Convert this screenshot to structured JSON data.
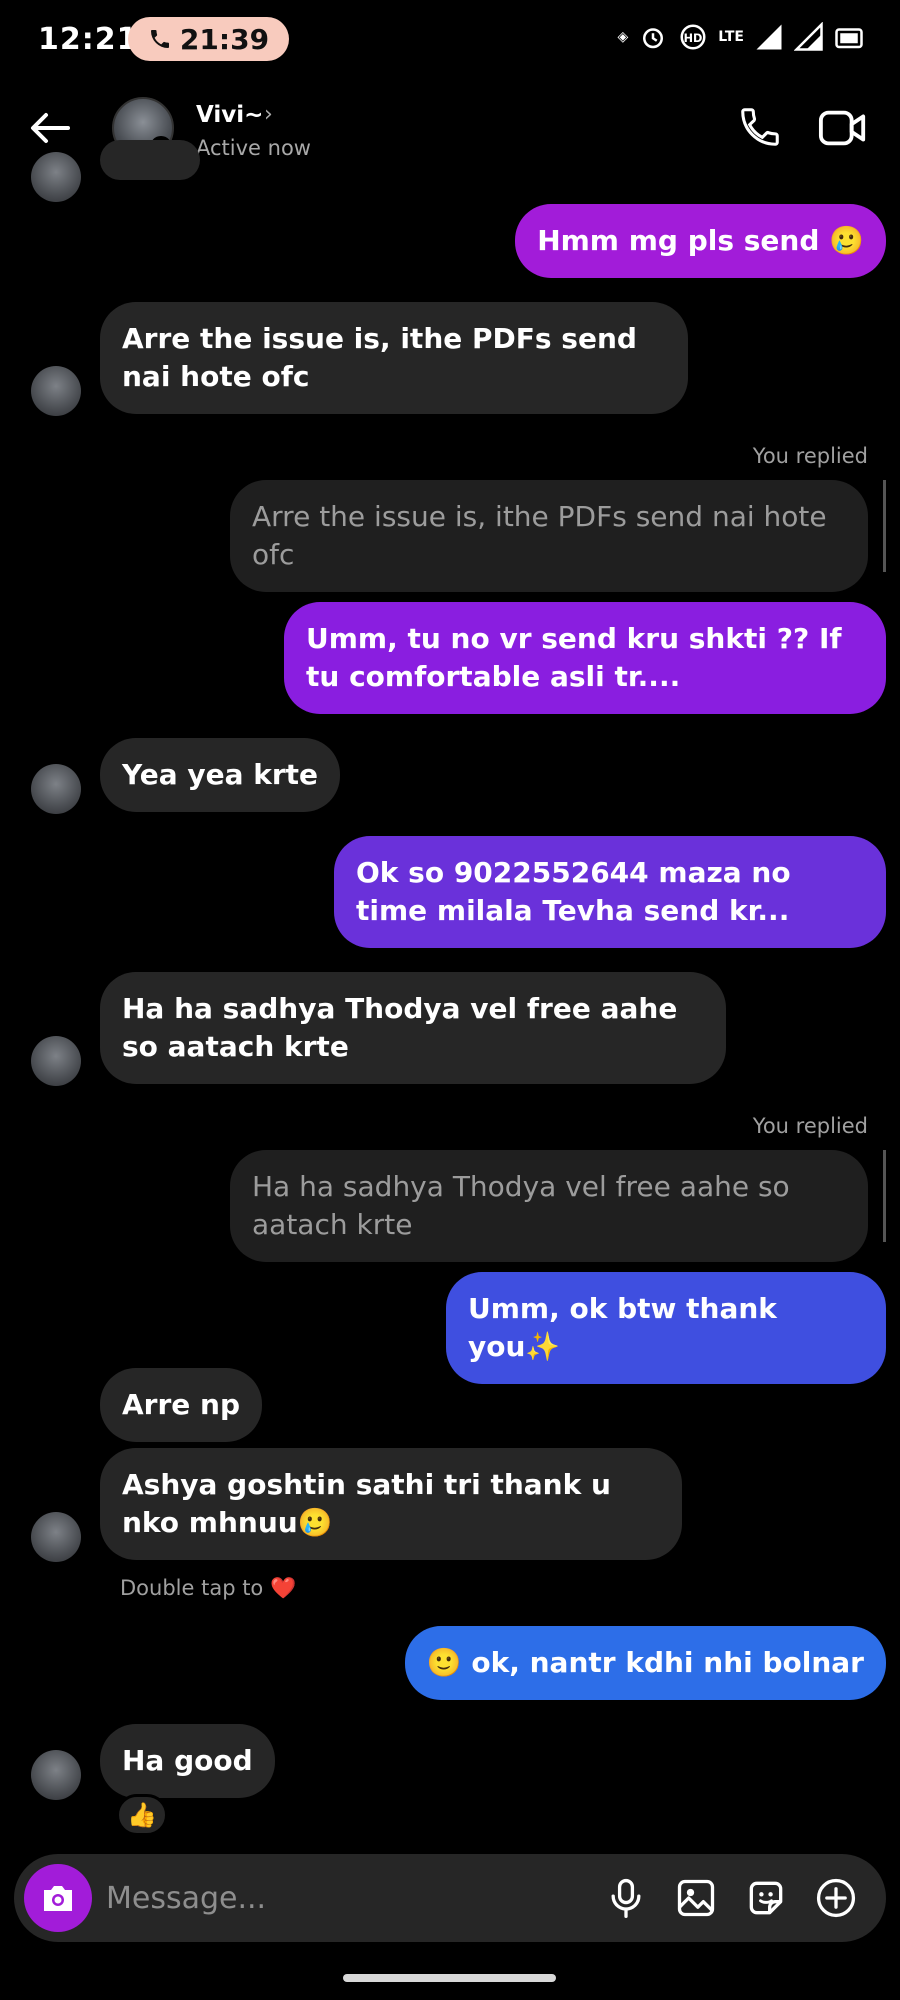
{
  "status_bar": {
    "clock": "12:21",
    "call_time": "21:39",
    "network": "LTE",
    "indicators": [
      "nfc-icon",
      "alarm-icon",
      "volte-icon",
      "lte-icon",
      "signal-icon",
      "signal-icon",
      "battery-icon"
    ]
  },
  "header": {
    "name": "Vivi~",
    "status": "Active now",
    "online_color": "#3ed33e"
  },
  "messages": [
    {
      "from": "me",
      "text": "Hmm mg pls send 🥲",
      "color": "#a21cd9"
    },
    {
      "from": "them",
      "text": "Arre the issue is, ithe PDFs send nai hote ofc"
    },
    {
      "from": "me",
      "replied_label": "You replied",
      "quote": "Arre the issue is, ithe PDFs send nai hote ofc",
      "text": "Umm, tu no vr send kru shkti ?? If tu comfortable asli tr....",
      "color": "#8a1ee0"
    },
    {
      "from": "them",
      "text": "Yea yea krte"
    },
    {
      "from": "me",
      "text": "Ok so 9022552644 maza no time milala Tevha send kr...",
      "color": "#6a31da"
    },
    {
      "from": "them",
      "text": "Ha ha sadhya Thodya vel free aahe so aatach krte"
    },
    {
      "from": "me",
      "replied_label": "You replied",
      "quote": "Ha ha sadhya Thodya vel free aahe so aatach krte",
      "text": "Umm, ok btw thank you✨",
      "color": "#3f4fe0"
    },
    {
      "from": "them",
      "text": "Arre np"
    },
    {
      "from": "them",
      "text": "Ashya goshtin sathi tri thank u nko mhnuu🥲",
      "hint": "Double tap to ❤️"
    },
    {
      "from": "me",
      "text": "🙂 ok, nantr kdhi nhi bolnar",
      "color": "#2d6ee8"
    },
    {
      "from": "them",
      "text": "Ha good",
      "reaction": "👍"
    }
  ],
  "composer": {
    "placeholder": "Message...",
    "icons": [
      "camera-icon",
      "microphone-icon",
      "gallery-icon",
      "sticker-icon",
      "add-icon"
    ]
  }
}
